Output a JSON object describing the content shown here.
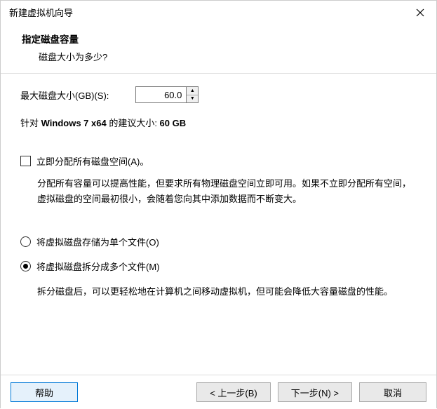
{
  "window": {
    "title": "新建虚拟机向导"
  },
  "header": {
    "title": "指定磁盘容量",
    "subtitle": "磁盘大小为多少?"
  },
  "maxDisk": {
    "label": "最大磁盘大小(GB)(S):",
    "value": "60.0"
  },
  "recommend": {
    "prefix": "针对 ",
    "os": "Windows 7 x64",
    "mid": " 的建议大小: ",
    "size": "60 GB"
  },
  "allocNow": {
    "label": "立即分配所有磁盘空间(A)。",
    "checked": false,
    "desc": "分配所有容量可以提高性能，但要求所有物理磁盘空间立即可用。如果不立即分配所有空间，虚拟磁盘的空间最初很小，会随着您向其中添加数据而不断变大。"
  },
  "storeOption": {
    "single": {
      "label": "将虚拟磁盘存储为单个文件(O)",
      "checked": false
    },
    "split": {
      "label": "将虚拟磁盘拆分成多个文件(M)",
      "checked": true,
      "desc": "拆分磁盘后，可以更轻松地在计算机之间移动虚拟机，但可能会降低大容量磁盘的性能。"
    }
  },
  "footer": {
    "help": "帮助",
    "back": "< 上一步(B)",
    "next": "下一步(N) >",
    "cancel": "取消"
  }
}
